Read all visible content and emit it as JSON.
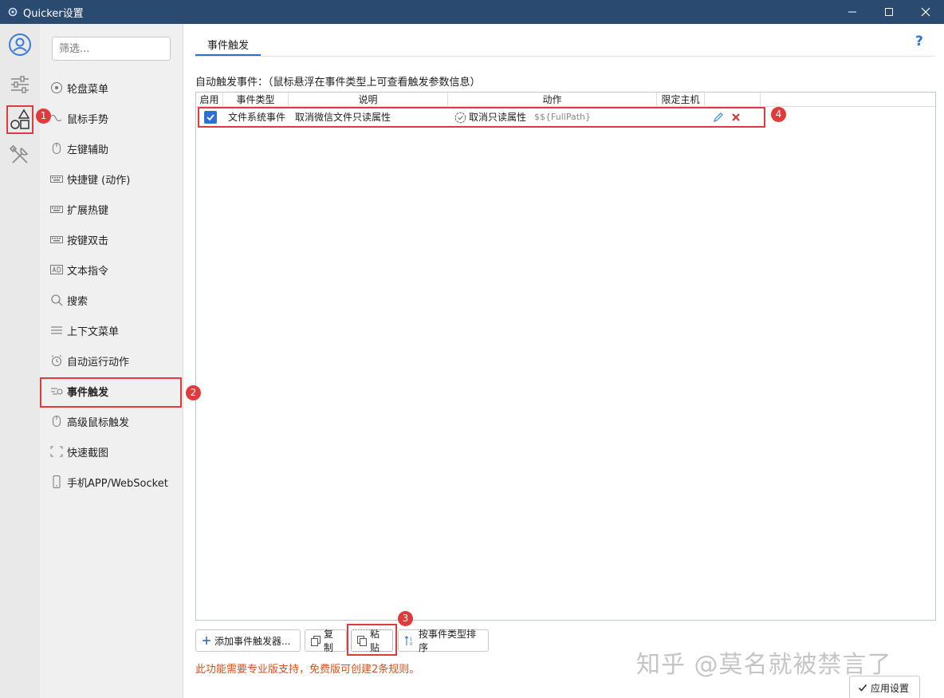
{
  "window": {
    "title": "Quicker设置",
    "icon": "gear-icon",
    "controls": [
      "minimize-icon",
      "maximize-icon",
      "close-icon"
    ]
  },
  "rail": {
    "items": [
      {
        "icon": "user-icon"
      },
      {
        "icon": "sliders-icon"
      },
      {
        "icon": "shapes-icon"
      },
      {
        "icon": "tools-icon"
      }
    ]
  },
  "nav": {
    "filter_placeholder": "筛选...",
    "items": [
      {
        "label": "轮盘菜单",
        "icon": "wheel-icon"
      },
      {
        "label": "鼠标手势",
        "icon": "gesture-icon"
      },
      {
        "label": "左键辅助",
        "icon": "mouse-icon"
      },
      {
        "label": "快捷键 (动作)",
        "icon": "keyboard-icon"
      },
      {
        "label": "扩展热键",
        "icon": "keyboard-icon"
      },
      {
        "label": "按键双击",
        "icon": "keyboard-icon"
      },
      {
        "label": "文本指令",
        "icon": "ad-icon"
      },
      {
        "label": "搜索",
        "icon": "search-icon"
      },
      {
        "label": "上下文菜单",
        "icon": "menu-icon"
      },
      {
        "label": "自动运行动作",
        "icon": "alarm-icon"
      },
      {
        "label": "事件触发",
        "icon": "event-icon"
      },
      {
        "label": "高级鼠标触发",
        "icon": "mouse-icon"
      },
      {
        "label": "快速截图",
        "icon": "screenshot-icon"
      },
      {
        "label": "手机APP/WebSocket",
        "icon": "phone-icon"
      }
    ],
    "active_index": 10
  },
  "main": {
    "tab": "事件触发",
    "help": "?",
    "section_label": "自动触发事件：（鼠标悬浮在事件类型上可查看触发参数信息）",
    "columns": [
      "启用",
      "事件类型",
      "说明",
      "动作",
      "限定主机"
    ],
    "rows": [
      {
        "enabled": true,
        "event_type": "文件系统事件",
        "description": "取消微信文件只读属性",
        "action": "取消只读属性",
        "action_param": "$${FullPath}",
        "host": ""
      }
    ]
  },
  "toolbar": {
    "add": "添加事件触发器...",
    "copy": "复制",
    "paste": "粘贴",
    "sort": "按事件类型排序"
  },
  "warning": "此功能需要专业版支持，免费版可创建2条规则。",
  "apply": "应用设置",
  "watermark": "知乎 @莫名就被禁言了",
  "annotations": [
    "1",
    "2",
    "3",
    "4"
  ],
  "colors": {
    "titlebar": "#2b4a70",
    "accent": "#2b6fc4",
    "annotation": "#e03a3a",
    "warning": "#d9501e"
  }
}
